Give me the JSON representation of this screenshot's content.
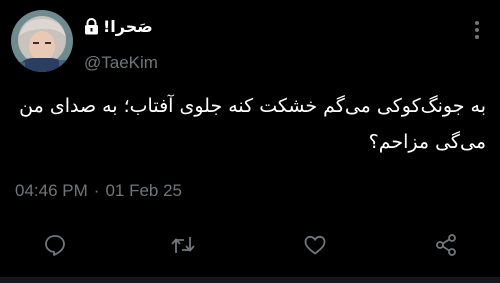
{
  "tweet": {
    "display_name": "صَحرا!",
    "handle": "@TaeKim",
    "text_line_1": "به جونگ‌کوکی می‌گم خشکت کنه جلوی آفتاب؛ به صدای من",
    "text_line_2": "می‌گی مزاحم؟",
    "time": "04:46 PM",
    "separator": "·",
    "date": "01 Feb 25",
    "protected": true
  },
  "icons": {
    "lock": "lock-icon",
    "more": "more-vertical-icon",
    "reply": "reply-icon",
    "retweet": "retweet-icon",
    "like": "heart-icon",
    "share": "share-icon"
  },
  "colors": {
    "background": "#000000",
    "text_primary": "#ffffff",
    "text_secondary": "#71767b",
    "icon": "#71767b"
  }
}
